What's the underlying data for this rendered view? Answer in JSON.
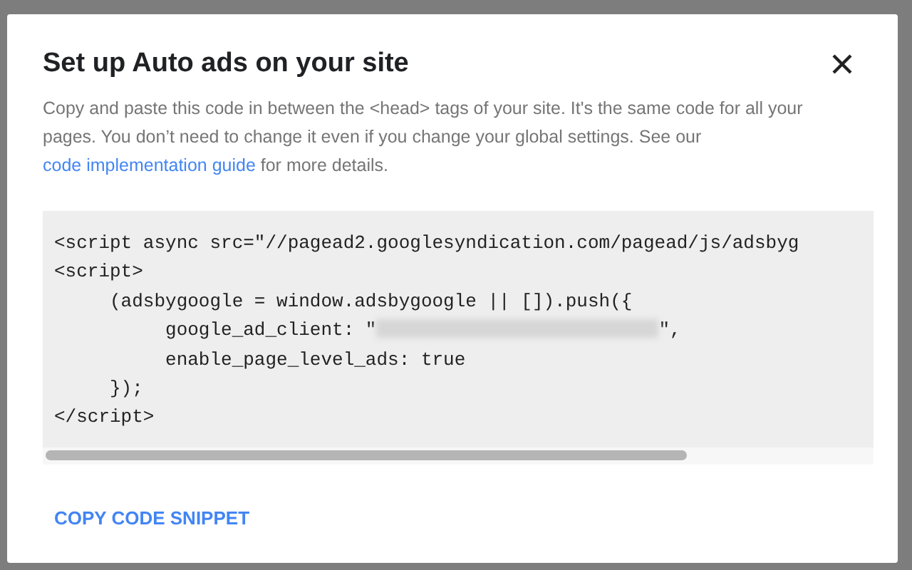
{
  "dialog": {
    "title": "Set up Auto ads on your site",
    "description": {
      "text": "Copy and paste this code in between the <head> tags of your site. It's the same code for all your pages. You don’t need to change it even if you change your global settings. See our ",
      "link": "code implementation guide",
      "after": " for more details."
    },
    "code_lines": [
      {
        "parts": [
          {
            "kind": "text",
            "text": "<script async src=\"//pagead2.googlesyndication.com/pagead/js/adsbyg"
          }
        ]
      },
      {
        "parts": [
          {
            "kind": "text",
            "text": "<script>"
          }
        ]
      },
      {
        "parts": [
          {
            "kind": "text",
            "text": "     (adsbygoogle = window.adsbygoogle || []).push({"
          }
        ]
      },
      {
        "parts": [
          {
            "kind": "text",
            "text": "          google_ad_client: \""
          },
          {
            "kind": "redacted"
          },
          {
            "kind": "text",
            "text": "\","
          }
        ]
      },
      {
        "parts": [
          {
            "kind": "text",
            "text": "          enable_page_level_ads: true"
          }
        ]
      },
      {
        "parts": [
          {
            "kind": "text",
            "text": "     });"
          }
        ]
      },
      {
        "parts": [
          {
            "kind": "text",
            "text": "</script>"
          }
        ]
      }
    ],
    "action": "COPY CODE SNIPPET"
  }
}
